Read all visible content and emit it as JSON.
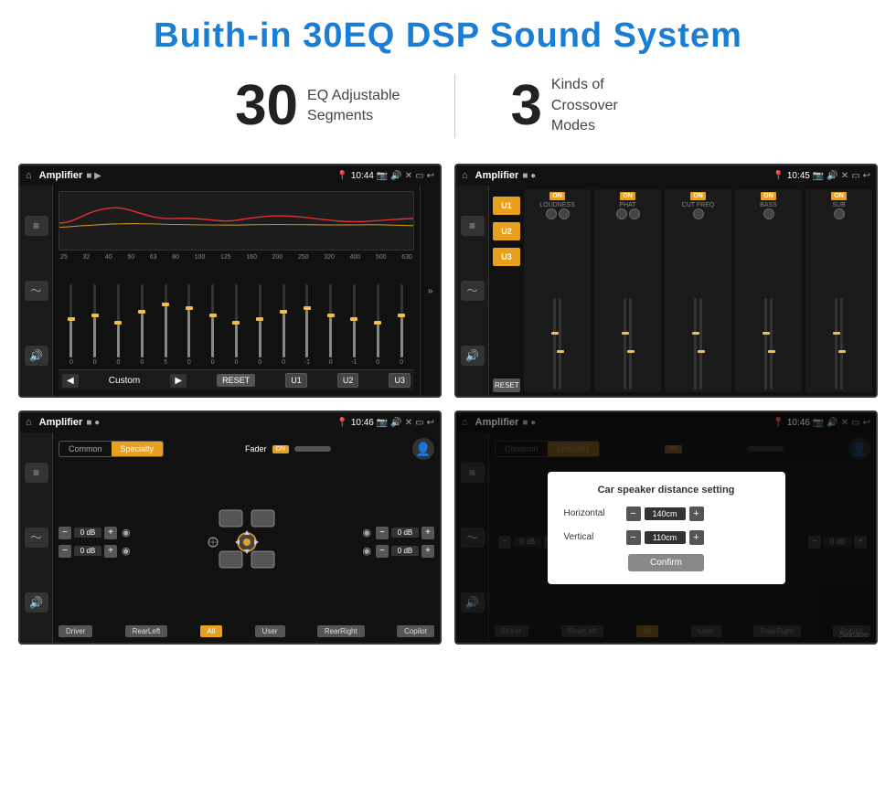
{
  "header": {
    "title": "Buith-in 30EQ DSP Sound System"
  },
  "stats": [
    {
      "number": "30",
      "label": "EQ Adjustable\nSegments"
    },
    {
      "number": "3",
      "label": "Kinds of\nCrossover Modes"
    }
  ],
  "panels": [
    {
      "id": "eq-panel",
      "statusBar": {
        "app": "Amplifier",
        "time": "10:44"
      },
      "freqLabels": [
        "25",
        "32",
        "40",
        "50",
        "63",
        "80",
        "100",
        "125",
        "160",
        "200",
        "250",
        "320",
        "400",
        "500",
        "630"
      ],
      "sliderPositions": [
        50,
        55,
        45,
        60,
        70,
        65,
        55,
        45,
        50,
        60,
        65,
        55,
        50,
        45,
        55
      ],
      "bottomButtons": [
        "◀",
        "Custom",
        "▶",
        "RESET",
        "U1",
        "U2",
        "U3"
      ]
    },
    {
      "id": "crossover-panel",
      "statusBar": {
        "app": "Amplifier",
        "time": "10:45"
      },
      "channels": [
        {
          "name": "LOUDNESS",
          "on": true
        },
        {
          "name": "PHAT",
          "on": true
        },
        {
          "name": "CUT FREQ",
          "on": true
        },
        {
          "name": "BASS",
          "on": true
        },
        {
          "name": "SUB",
          "on": true
        }
      ],
      "uButtons": [
        "U1",
        "U2",
        "U3"
      ],
      "resetLabel": "RESET"
    },
    {
      "id": "fader-panel",
      "statusBar": {
        "app": "Amplifier",
        "time": "10:46"
      },
      "tabs": [
        "Common",
        "Specialty"
      ],
      "activeTab": "Specialty",
      "faderLabel": "Fader",
      "faderOnLabel": "ON",
      "dbValues": [
        "0 dB",
        "0 dB",
        "0 dB",
        "0 dB"
      ],
      "speakerLabels": [
        "Driver",
        "RearLeft",
        "All",
        "User",
        "RearRight",
        "Copilot"
      ],
      "activeLabel": "All"
    },
    {
      "id": "dialog-panel",
      "statusBar": {
        "app": "Amplifier",
        "time": "10:46"
      },
      "tabs": [
        "Common",
        "Specialty"
      ],
      "activeTab": "Specialty",
      "dialog": {
        "title": "Car speaker distance setting",
        "rows": [
          {
            "label": "Horizontal",
            "value": "140cm"
          },
          {
            "label": "Vertical",
            "value": "110cm"
          }
        ],
        "confirmLabel": "Confirm"
      },
      "dbValues": [
        "0 dB",
        "0 dB"
      ],
      "speakerLabels": [
        "Driver",
        "RearLeft",
        "All",
        "User",
        "RearRight",
        "Copilot"
      ]
    }
  ],
  "watermark": "Seicane"
}
